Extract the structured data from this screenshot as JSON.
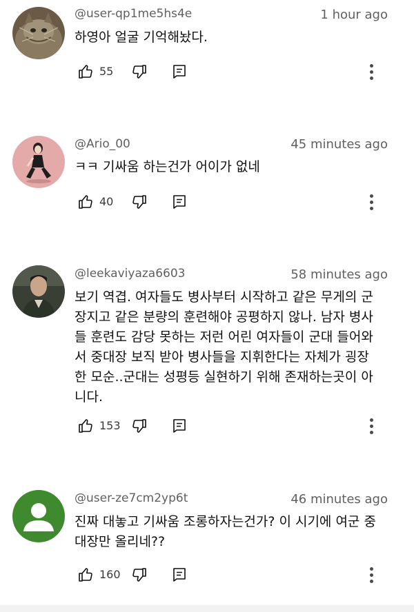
{
  "comments": [
    {
      "author": "@user-qp1me5hs4e",
      "time": "1 hour ago",
      "text": "하영아 얼굴 기억해놨다.",
      "likes": "55",
      "avatar": "cat-photo"
    },
    {
      "author": "@Ario_00",
      "time": "45 minutes ago",
      "text": "ㅋㅋ 기싸움 하는건가 어이가 없네",
      "likes": "40",
      "avatar": "girl-photo"
    },
    {
      "author": "@leekaviyaza6603",
      "time": "58 minutes ago",
      "text": "보기 역겹. 여자들도 병사부터 시작하고 같은 무게의 군\n장지고 같은 분량의 훈련해야 공평하지 않나. 남자 병사\n들 훈련도 감당 못하는 저런 어린 여자들이 군대 들어와\n서 중대장 보직 받아 병사들을 지휘한다는 자체가 굉장\n한 모순..군대는 성평등 실현하기 위해 존재하는곳이 아\n니다.",
      "likes": "153",
      "avatar": "man-photo"
    },
    {
      "author": "@user-ze7cm2yp6t",
      "time": "46 minutes ago",
      "text": "진짜 대놓고 기싸움 조롱하자는건가? 이 시기에 여군 중\n대장만 올리네??",
      "likes": "160",
      "avatar": "default-user-icon"
    }
  ],
  "icons": {
    "like": "thumb-up-icon",
    "dislike": "thumb-down-icon",
    "reply": "reply-icon",
    "more": "more-vert-icon"
  },
  "colors": {
    "meta_text": "#606060",
    "default_avatar_bg": "#3f8a2f"
  }
}
